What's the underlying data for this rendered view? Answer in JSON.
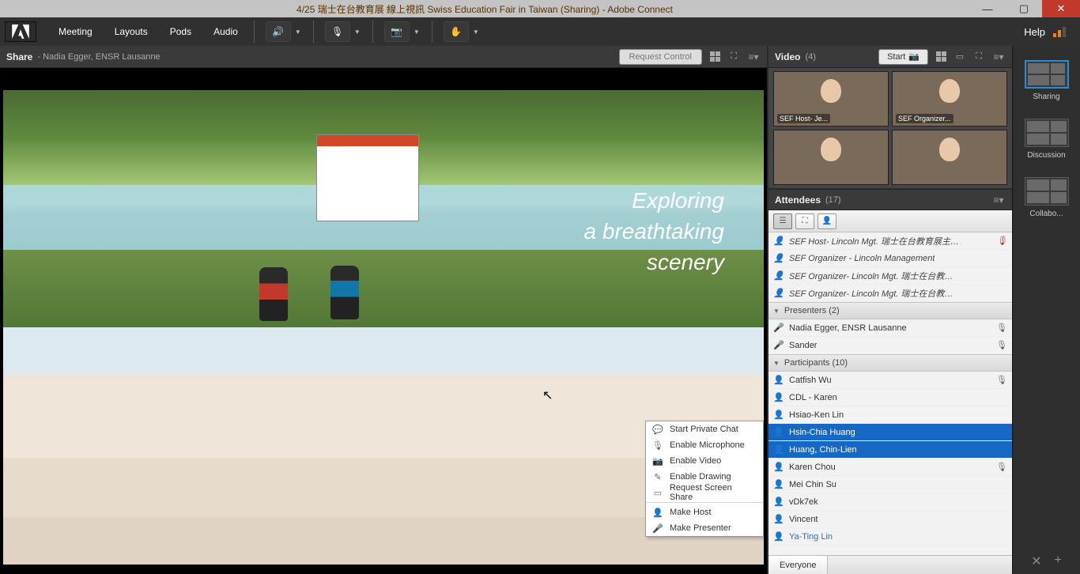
{
  "window": {
    "title": "4/25 瑞士在台教育展 線上視訊 Swiss Education Fair in Taiwan (Sharing) - Adobe Connect"
  },
  "menu": {
    "items": [
      "Meeting",
      "Layouts",
      "Pods",
      "Audio"
    ],
    "help": "Help"
  },
  "share": {
    "title": "Share",
    "subtitle": "- Nadia Egger, ENSR Lausanne",
    "request_control": "Request Control",
    "scene_text": "Exploring\na breathtaking\nscenery"
  },
  "video": {
    "title": "Video",
    "count": "(4)",
    "start": "Start",
    "tiles": [
      "SEF Host- Je...",
      "SEF Organizer...",
      "",
      ""
    ]
  },
  "attendees": {
    "title": "Attendees",
    "count": "(17)",
    "hosts": [
      "SEF Host- Lincoln Mgt. 瑞士在台教育展主辦...",
      "SEF Organizer - Lincoln Management",
      "SEF Organizer- Lincoln Mgt. 瑞士在台教育展主...",
      "SEF Organizer- Lincoln Mgt. 瑞士在台教育展主..."
    ],
    "presenters_header": "Presenters (2)",
    "presenters": [
      {
        "name": "Nadia Egger, ENSR Lausanne",
        "mic": true
      },
      {
        "name": "Sander",
        "mic": true
      }
    ],
    "participants_header": "Participants (10)",
    "participants": [
      {
        "name": "Catfish Wu",
        "mic": true,
        "sel": false
      },
      {
        "name": "CDL - Karen",
        "mic": false,
        "sel": false
      },
      {
        "name": "Hsiao-Ken Lin",
        "mic": false,
        "sel": false
      },
      {
        "name": "Hsin-Chia Huang",
        "mic": false,
        "sel": true
      },
      {
        "name": "Huang, Chin-Lien",
        "mic": false,
        "sel": true
      },
      {
        "name": "Karen Chou",
        "mic": true,
        "sel": false
      },
      {
        "name": "Mei Chin Su",
        "mic": false,
        "sel": false
      },
      {
        "name": "vDk7ek",
        "mic": false,
        "sel": false
      },
      {
        "name": "Vincent",
        "mic": false,
        "sel": false
      },
      {
        "name": "Ya-Ting Lin",
        "mic": false,
        "sel": false,
        "link": true
      }
    ],
    "everyone_tab": "Everyone"
  },
  "context_menu": {
    "items": [
      "Start Private Chat",
      "Enable Microphone",
      "Enable Video",
      "Enable Drawing",
      "Request Screen Share",
      "Make Host",
      "Make Presenter"
    ]
  },
  "layouts": {
    "items": [
      "Sharing",
      "Discussion",
      "Collabo..."
    ]
  }
}
